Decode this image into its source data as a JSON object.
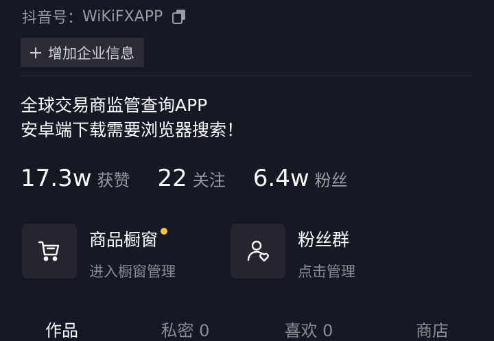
{
  "profile": {
    "id_label": "抖音号：",
    "id_value": "WiKiFXAPP",
    "add_enterprise_label": "增加企业信息",
    "bio_line1": "全球交易商监管查询APP",
    "bio_line2": "安卓端下载需要浏览器搜索！"
  },
  "stats": [
    {
      "value": "17.3w",
      "label": "获赞"
    },
    {
      "value": "22",
      "label": "关注"
    },
    {
      "value": "6.4w",
      "label": "粉丝"
    }
  ],
  "cards": [
    {
      "title": "商品橱窗",
      "subtitle": "进入橱窗管理",
      "icon": "cart-icon",
      "has_dot": true
    },
    {
      "title": "粉丝群",
      "subtitle": "点击管理",
      "icon": "fan-group-icon",
      "has_dot": false
    }
  ],
  "tabs": [
    {
      "label": "作品"
    },
    {
      "label": "私密 0"
    },
    {
      "label": "喜欢 0"
    },
    {
      "label": "商店"
    }
  ],
  "colors": {
    "background": "#161823",
    "dot": "#f7c33d",
    "muted": "#9a9ba3"
  }
}
